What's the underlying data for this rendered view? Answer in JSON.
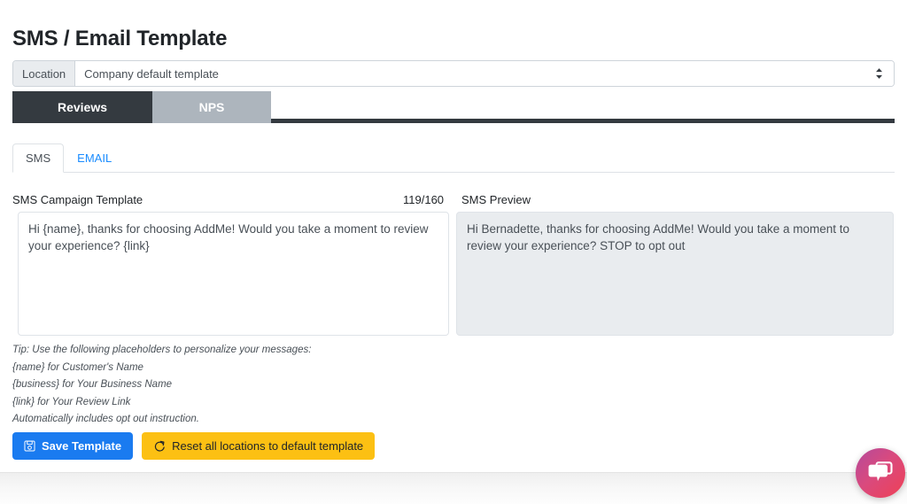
{
  "page": {
    "title": "SMS / Email Template"
  },
  "location": {
    "label": "Location",
    "selected": "Company default template",
    "options": [
      "Company default template"
    ]
  },
  "mode_tabs": [
    {
      "label": "Reviews",
      "active": true
    },
    {
      "label": "NPS",
      "active": false
    }
  ],
  "channel_tabs": [
    {
      "label": "SMS",
      "active": true
    },
    {
      "label": "EMAIL",
      "active": false
    }
  ],
  "editor": {
    "template_label": "SMS Campaign Template",
    "char_count": "119/160",
    "template_value": "Hi {name}, thanks for choosing AddMe! Would you take a moment to review your experience? {link}"
  },
  "preview": {
    "label": "SMS Preview",
    "text": "Hi Bernadette, thanks for choosing AddMe! Would you take a moment to review your experience?  STOP to opt out"
  },
  "tips": [
    "Tip: Use the following placeholders to personalize your messages:",
    "{name} for Customer's Name",
    "{business} for Your Business Name",
    "{link} for Your Review Link",
    "Automatically includes opt out instruction."
  ],
  "buttons": {
    "save": {
      "label": "Save Template",
      "icon": "save-icon",
      "color": "#1a7bf0"
    },
    "reset": {
      "label": "Reset all locations to default template",
      "icon": "refresh-icon",
      "color": "#fcc013"
    }
  },
  "chat_widget": {
    "icon": "chat-bubbles-icon",
    "color_start": "#b44a9c",
    "color_end": "#ef4055"
  }
}
